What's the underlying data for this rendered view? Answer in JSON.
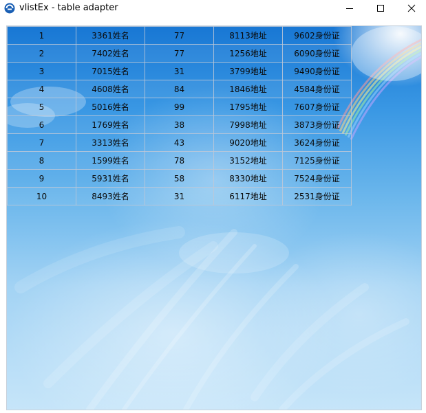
{
  "window": {
    "title": "vlistEx - table adapter",
    "icon": "app-icon",
    "controls": {
      "minimize": "minimize-icon",
      "maximize": "maximize-icon",
      "close": "close-icon"
    }
  },
  "table": {
    "rows": [
      [
        "1",
        "3361姓名",
        "77",
        "8113地址",
        "9602身份证"
      ],
      [
        "2",
        "7402姓名",
        "77",
        "1256地址",
        "6090身份证"
      ],
      [
        "3",
        "7015姓名",
        "31",
        "3799地址",
        "9490身份证"
      ],
      [
        "4",
        "4608姓名",
        "84",
        "1846地址",
        "4584身份证"
      ],
      [
        "5",
        "5016姓名",
        "99",
        "1795地址",
        "7607身份证"
      ],
      [
        "6",
        "1769姓名",
        "38",
        "7998地址",
        "3873身份证"
      ],
      [
        "7",
        "3313姓名",
        "43",
        "9020地址",
        "3624身份证"
      ],
      [
        "8",
        "1599姓名",
        "78",
        "3152地址",
        "7125身份证"
      ],
      [
        "9",
        "5931姓名",
        "58",
        "8330地址",
        "7524身份证"
      ],
      [
        "10",
        "8493姓名",
        "31",
        "6117地址",
        "2531身份证"
      ]
    ]
  },
  "colors": {
    "sky_top": "#1877d4",
    "sky_bottom": "#c6e5f9",
    "grid": "#bec8d7"
  }
}
